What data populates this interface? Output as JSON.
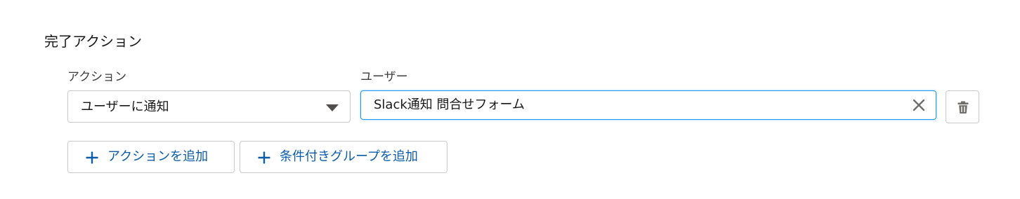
{
  "section": {
    "title": "完了アクション"
  },
  "action_field": {
    "label": "アクション",
    "value": "ユーザーに通知"
  },
  "user_field": {
    "label": "ユーザー",
    "value": "Slack通知 問合せフォーム"
  },
  "buttons": {
    "add_action": "アクションを追加",
    "add_conditional_group": "条件付きグループを追加"
  },
  "icons": {
    "select_caret": "chevron-down-icon",
    "clear": "close-icon",
    "delete": "trash-icon",
    "add": "plus-icon"
  },
  "colors": {
    "brand_blue": "#0b5cab",
    "focus_border": "#1b96ff",
    "border": "#c9c9c9",
    "icon_gray": "#706e6b"
  }
}
